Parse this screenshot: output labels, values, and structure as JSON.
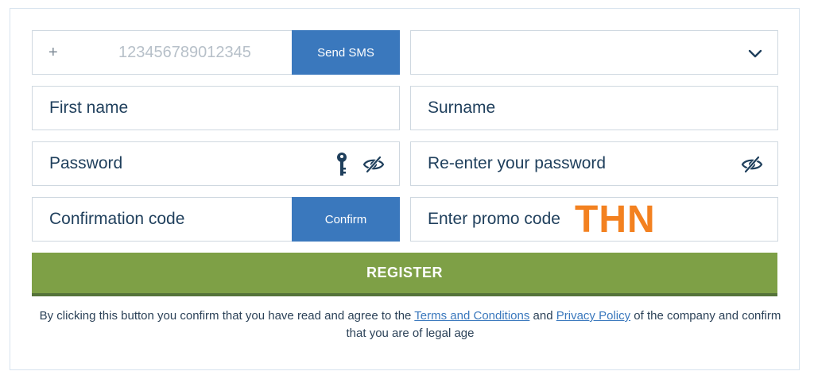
{
  "phone": {
    "prefix": "+",
    "placeholder": "123456789012345",
    "send_sms_label": "Send SMS"
  },
  "country_select": {
    "value": ""
  },
  "first_name": {
    "placeholder": "First name"
  },
  "surname": {
    "placeholder": "Surname"
  },
  "password": {
    "placeholder": "Password"
  },
  "reenter_password": {
    "placeholder": "Re-enter your password"
  },
  "confirmation": {
    "placeholder": "Confirmation code",
    "button_label": "Confirm"
  },
  "promo": {
    "placeholder": "Enter promo code",
    "code": "THN"
  },
  "register_label": "REGISTER",
  "legal": {
    "part1": "By clicking this button you confirm that you have read and agree to the ",
    "terms_link": "Terms and Conditions",
    "part2": " and ",
    "privacy_link": "Privacy Policy",
    "part3": " of the company and confirm that you are of legal age"
  },
  "icons": {
    "chevron": "chevron-down-icon",
    "key": "key-icon",
    "eye": "eye-slash-icon"
  },
  "colors": {
    "accent_blue": "#3a78bd",
    "register_green": "#7ea046",
    "promo_orange": "#f38120",
    "text": "#1f3f5c"
  }
}
